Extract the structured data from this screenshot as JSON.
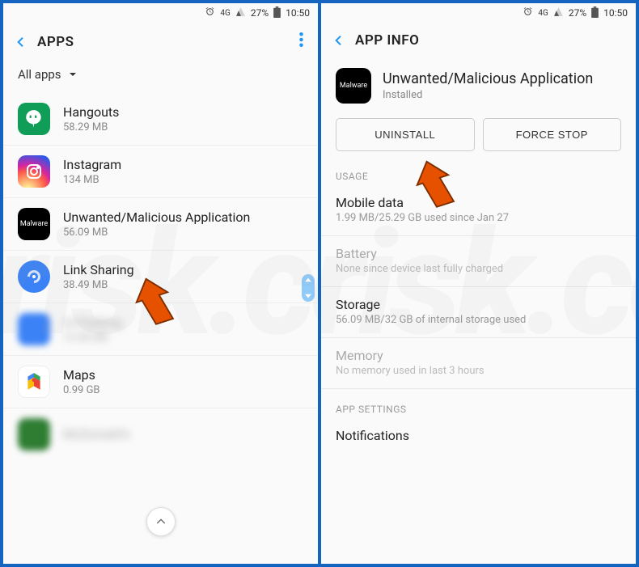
{
  "status": {
    "network": "4G",
    "battery_pct": "27%",
    "time": "10:50"
  },
  "left": {
    "title": "APPS",
    "filter_label": "All apps",
    "apps": [
      {
        "name": "Hangouts",
        "size": "58.29 MB"
      },
      {
        "name": "Instagram",
        "size": "134 MB"
      },
      {
        "name": "Unwanted/Malicious Application",
        "size": "56.09 MB"
      },
      {
        "name": "Link Sharing",
        "size": "38.49 MB"
      },
      {
        "name": "m-Parking",
        "size": "13.48 MB"
      },
      {
        "name": "Maps",
        "size": "0.99 GB"
      },
      {
        "name": "McDonald's",
        "size": ""
      }
    ]
  },
  "right": {
    "title": "APP INFO",
    "app_name": "Unwanted/Malicious Application",
    "install_status": "Installed",
    "btn_uninstall": "UNINSTALL",
    "btn_forcestop": "FORCE STOP",
    "section_usage": "USAGE",
    "usage": [
      {
        "k": "Mobile data",
        "v": "1.99 MB/25.29 GB used since Jan 27",
        "dim": false
      },
      {
        "k": "Battery",
        "v": "None since device last fully charged",
        "dim": true
      },
      {
        "k": "Storage",
        "v": "56.09 MB/32 GB of internal storage used",
        "dim": false
      },
      {
        "k": "Memory",
        "v": "No memory used in last 3 hours",
        "dim": true
      }
    ],
    "section_settings": "APP SETTINGS",
    "settings_first": "Notifications"
  },
  "watermark_text": "PCrisk.com"
}
